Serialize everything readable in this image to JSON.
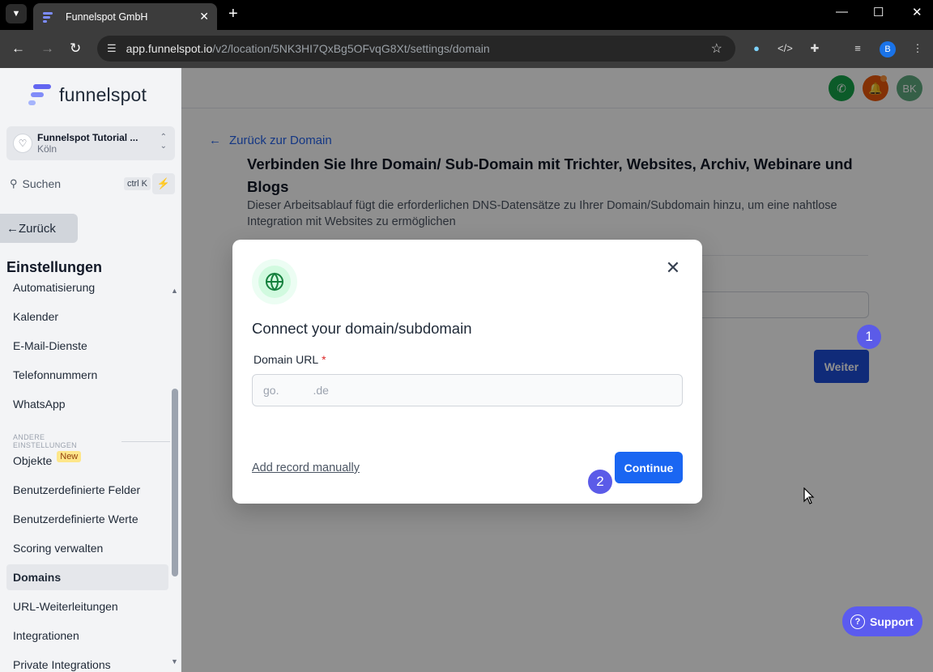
{
  "browser": {
    "tab_title": "Funnelspot GmbH",
    "url_host": "app.funnelspot.io",
    "url_path": "/v2/location/5NK3HI7QxBg5OFvqG8Xt/settings/domain",
    "profile_initial": "B"
  },
  "brand": {
    "name": "funnelspot"
  },
  "location": {
    "name": "Funnelspot Tutorial ...",
    "city": "Köln"
  },
  "search": {
    "placeholder": "Suchen",
    "shortcut": "ctrl K"
  },
  "sidebar": {
    "back_label": "Zurück",
    "section_title": "Einstellungen",
    "items": [
      {
        "label": "Automatisierung"
      },
      {
        "label": "Kalender"
      },
      {
        "label": "E-Mail-Dienste"
      },
      {
        "label": "Telefonnummern"
      },
      {
        "label": "WhatsApp"
      },
      {
        "label": "ANDERE EINSTELLUNGEN"
      },
      {
        "label": "Objekte",
        "badge": "New"
      },
      {
        "label": "Benutzerdefinierte Felder"
      },
      {
        "label": "Benutzerdefinierte Werte"
      },
      {
        "label": "Scoring verwalten"
      },
      {
        "label": "Domains"
      },
      {
        "label": "URL-Weiterleitungen"
      },
      {
        "label": "Integrationen"
      },
      {
        "label": "Private Integrations"
      }
    ]
  },
  "topbar": {
    "user_initials": "BK"
  },
  "page": {
    "back_link": "Zurück zur Domain",
    "title": "Verbinden Sie Ihre Domain/ Sub-Domain mit Trichter, Websites, Archiv, Webinare und Blogs",
    "description": "Dieser Arbeitsablauf fügt die erforderlichen DNS-Datensätze zu Ihrer Domain/Subdomain hinzu, um eine nahtlose Integration mit Websites zu ermöglichen",
    "next_button": "Weiter",
    "step1": "1",
    "step2": "2"
  },
  "modal": {
    "title": "Connect your domain/subdomain",
    "field_label": "Domain URL",
    "required_mark": "*",
    "field_placeholder": "go.   .de",
    "manual_link": "Add record manually",
    "continue_button": "Continue"
  },
  "support": {
    "label": "Support"
  },
  "colors": {
    "primary": "#1a66f2",
    "step_badge": "#5b5be8",
    "phone_button": "#16a34a",
    "notification_button": "#ea580c",
    "avatar": "#5fa97f"
  }
}
